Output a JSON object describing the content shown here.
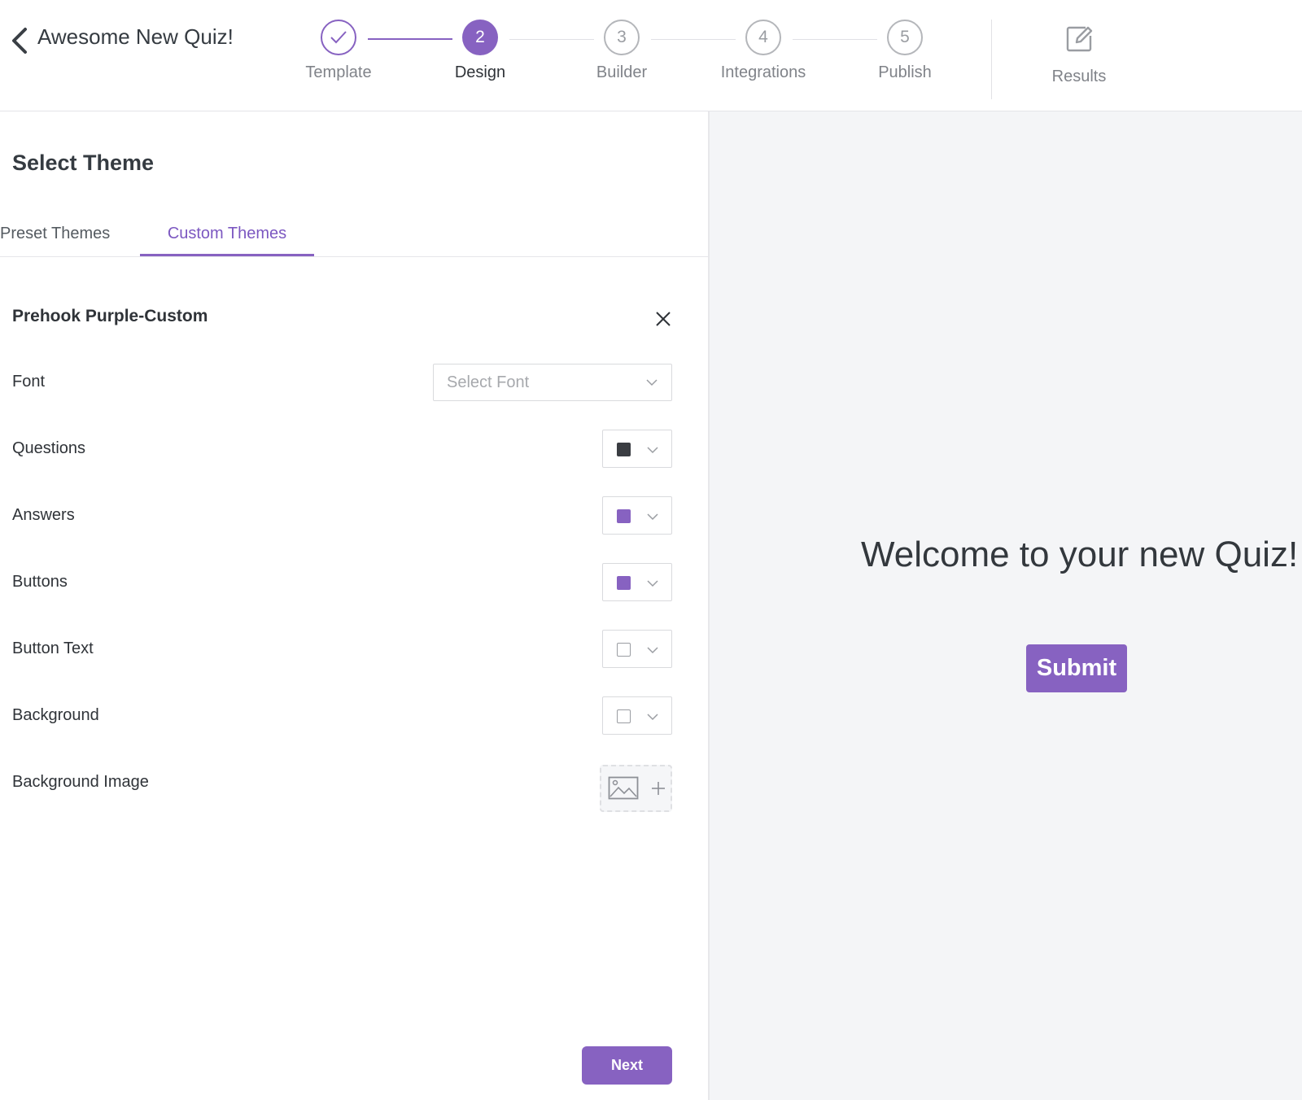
{
  "header": {
    "title": "Awesome New Quiz!",
    "steps": [
      {
        "number": "",
        "label": "Template",
        "status": "completed"
      },
      {
        "number": "2",
        "label": "Design",
        "status": "active"
      },
      {
        "number": "3",
        "label": "Builder",
        "status": "upcoming"
      },
      {
        "number": "4",
        "label": "Integrations",
        "status": "upcoming"
      },
      {
        "number": "5",
        "label": "Publish",
        "status": "upcoming"
      }
    ],
    "results_label": "Results"
  },
  "panel": {
    "title": "Select Theme",
    "tabs": [
      {
        "label": "Preset Themes",
        "active": false
      },
      {
        "label": "Custom Themes",
        "active": true
      }
    ],
    "theme_name": "Prehook Purple-Custom",
    "font": {
      "label": "Font",
      "placeholder": "Select Font"
    },
    "colors": [
      {
        "label": "Questions",
        "color": "#3a3d42"
      },
      {
        "label": "Answers",
        "color": "#8762c1"
      },
      {
        "label": "Buttons",
        "color": "#8762c1"
      },
      {
        "label": "Button Text",
        "color": "#ffffff"
      },
      {
        "label": "Background",
        "color": "#ffffff"
      }
    ],
    "background_image": {
      "label": "Background Image"
    },
    "next_label": "Next"
  },
  "preview": {
    "welcome": "Welcome to your new Quiz!",
    "submit_label": "Submit"
  },
  "theme": {
    "accent": "#8762c1",
    "preview_background": "#f4f5f7"
  }
}
